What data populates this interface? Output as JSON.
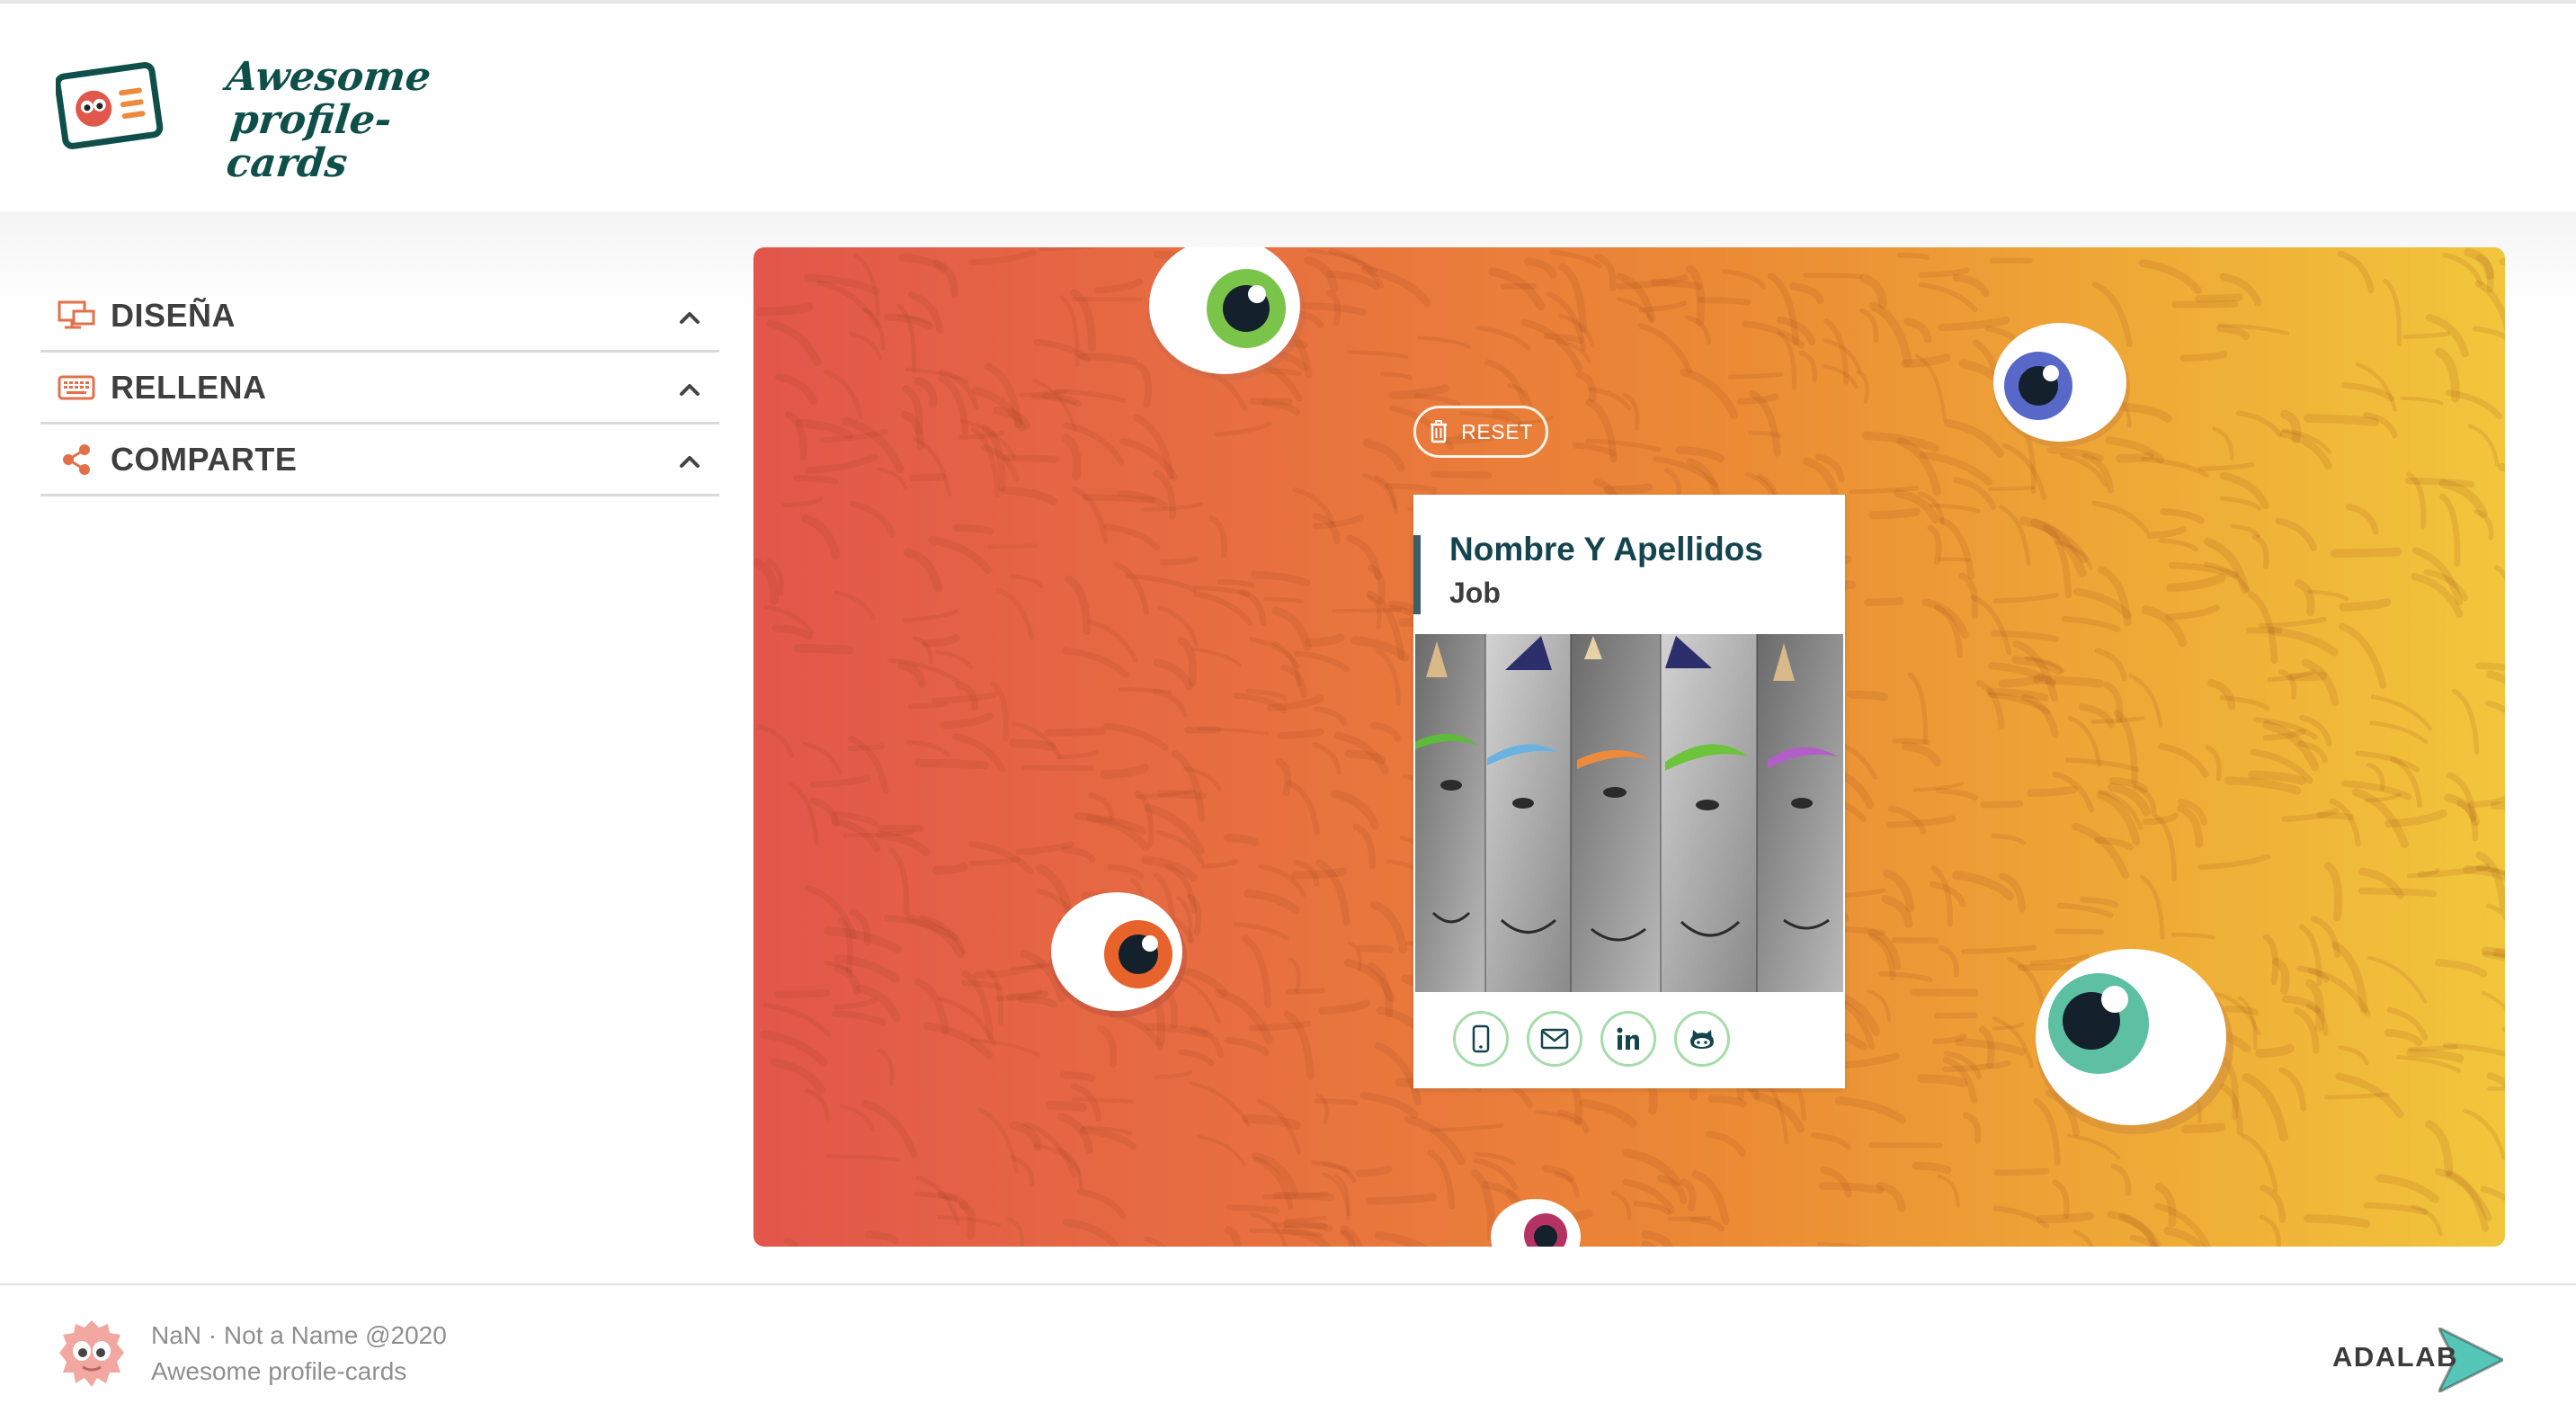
{
  "header": {
    "logo_line1": "Awesome",
    "logo_line2": "profile-cards"
  },
  "sidebar": {
    "sections": [
      {
        "label": "DISEÑA",
        "icon": "design-icon",
        "expanded": true
      },
      {
        "label": "RELLENA",
        "icon": "keyboard-icon",
        "expanded": true
      },
      {
        "label": "COMPARTE",
        "icon": "share-icon",
        "expanded": true
      }
    ]
  },
  "preview": {
    "reset_label": "RESET",
    "card": {
      "name": "Nombre Y Apellidos",
      "job": "Job",
      "social": [
        "phone-icon",
        "mail-icon",
        "linkedin-icon",
        "github-icon"
      ]
    }
  },
  "footer": {
    "credit": "NaN · Not a Name @2020",
    "project": "Awesome profile-cards",
    "brand": "ADALAB"
  },
  "colors": {
    "accent_orange": "#e2704a",
    "title_green": "#14454e",
    "social_border": "#a6dcaa",
    "gradient_start": "#e2564b",
    "gradient_end": "#f2c63c"
  }
}
